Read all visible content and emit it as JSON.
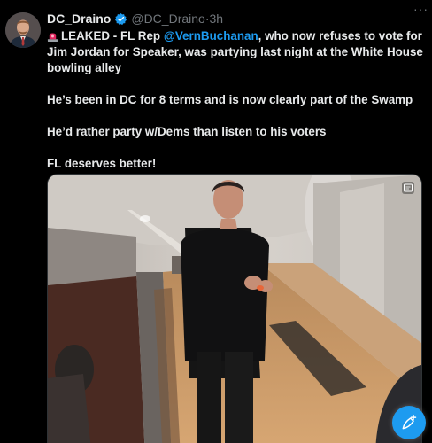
{
  "author": {
    "display_name": "DC_Draino",
    "handle": "@DC_Draino",
    "separator": "·",
    "time": "3h",
    "verified_color": "#1d9bf0"
  },
  "tweet": {
    "line1_lead": "LEAKED - FL Rep ",
    "line1_mention": "@VernBuchanan",
    "line1_tail": ", who now refuses to vote for Jim Jordan for Speaker, was partying last night at the White House bowling alley",
    "paragraph2": "He’s been in DC for 8 terms and is now clearly part of the Swamp",
    "paragraph3": "He’d rather party w/Dems than listen to his voters",
    "paragraph4": "FL deserves better!",
    "lead_emoji": "siren-icon"
  },
  "media": {
    "description_icon": "bowling-video-frame",
    "badge_icon": "gif-icon"
  },
  "icons": {
    "more": "more-icon",
    "compose": "compose-icon"
  },
  "colors": {
    "background": "#000000",
    "text": "#e7e9ea",
    "secondary": "#71767b",
    "accent": "#1d9bf0"
  }
}
